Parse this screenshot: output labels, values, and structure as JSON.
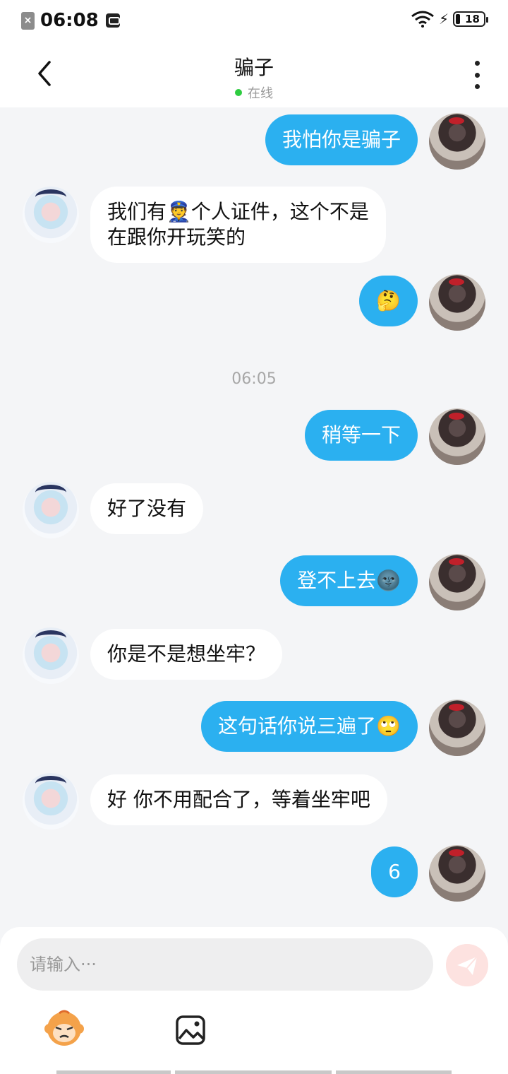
{
  "status_bar": {
    "time": "06:08",
    "battery": "18"
  },
  "header": {
    "title": "骗子",
    "status": "在线"
  },
  "messages": [
    {
      "side": "me",
      "text": "我怕你是骗子"
    },
    {
      "side": "other",
      "text": "我们有👮个人证件，这个不是\n在跟你开玩笑的"
    },
    {
      "side": "me",
      "text": "🤔"
    },
    {
      "side": "time",
      "text": "06:05"
    },
    {
      "side": "me",
      "text": "稍等一下"
    },
    {
      "side": "other",
      "text": "好了没有"
    },
    {
      "side": "me",
      "text": "登不上去🌚"
    },
    {
      "side": "other",
      "text": "你是不是想坐牢？"
    },
    {
      "side": "me",
      "text": "这句话你说三遍了🙄"
    },
    {
      "side": "other",
      "text": "好 你不用配合了，等着坐牢吧"
    },
    {
      "side": "me",
      "text": "6"
    }
  ],
  "input": {
    "placeholder": "请输入···"
  },
  "colors": {
    "accent": "#2bb0f0",
    "online": "#2ecc40",
    "send": "#fde2e0"
  }
}
